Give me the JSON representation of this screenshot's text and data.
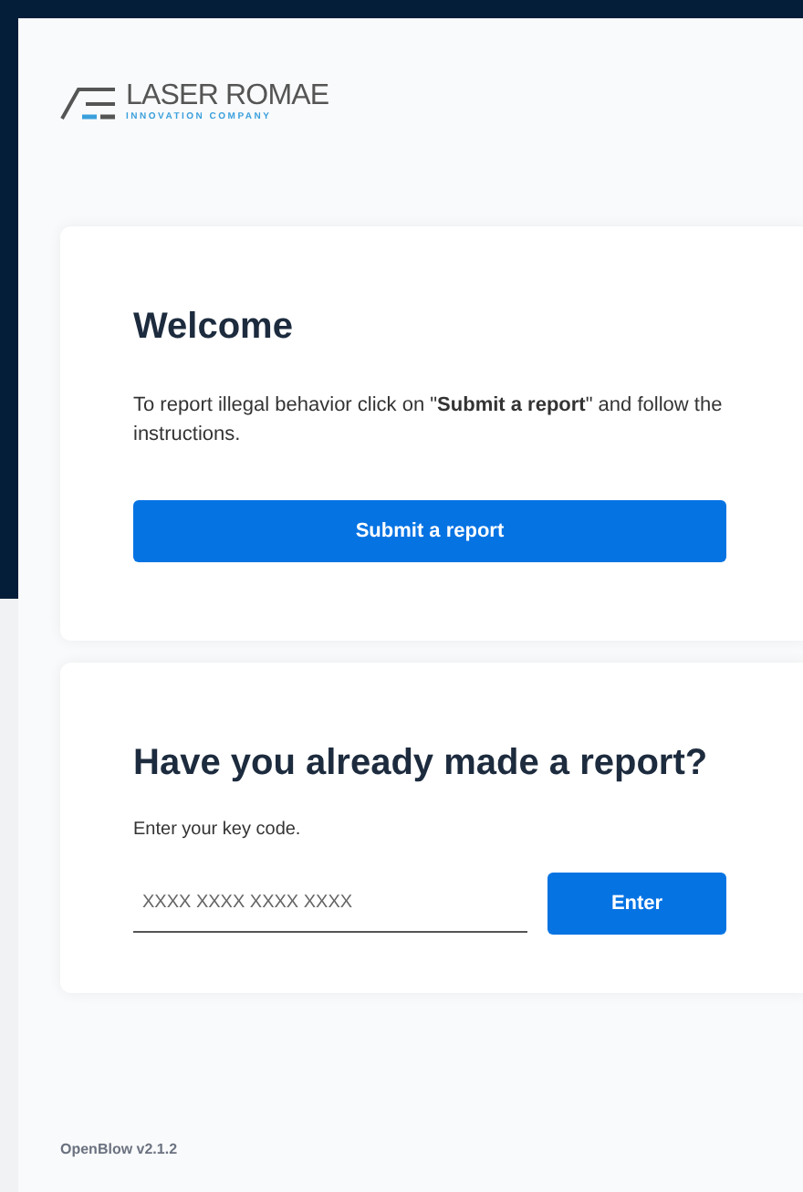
{
  "logo": {
    "name": "LASER ROMAE",
    "tagline": "INNOVATION COMPANY"
  },
  "welcome_card": {
    "title": "Welcome",
    "text": "To report illegal behavior click on \"**Submit a report**\" and follow the instructions.",
    "button": "Submit a report"
  },
  "report_card": {
    "title": "Have you already made a report?",
    "label": "Enter your key code.",
    "key_field": {
      "placeholder": "XXXX XXXX XXXX XXXX"
    },
    "button": "Enter"
  },
  "footer": {
    "version": "OpenBlow v2.1.2"
  }
}
